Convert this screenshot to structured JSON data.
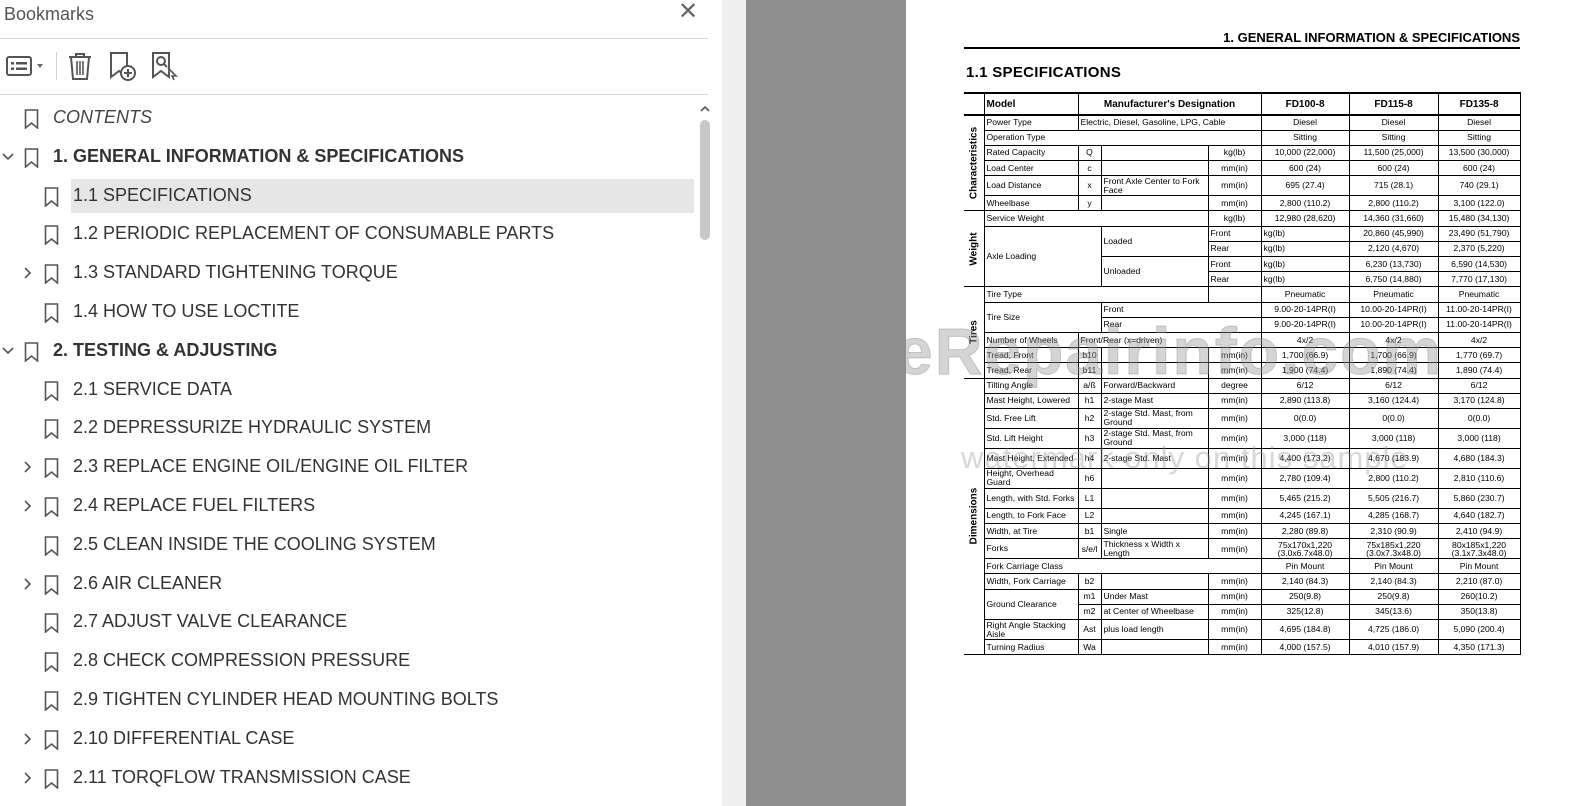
{
  "bookmarks_panel": {
    "title": "Bookmarks",
    "toolbar": {
      "options_icon": "list-options-icon",
      "delete_icon": "trash-icon",
      "new_bookmark_icon": "bookmark-add-icon",
      "find_bookmark_icon": "bookmark-search-icon"
    },
    "items": [
      {
        "label": "CONTENTS",
        "level": 0,
        "expander": "none",
        "style": "italic"
      },
      {
        "label": "1. GENERAL INFORMATION & SPECIFICATIONS",
        "level": 0,
        "expander": "expanded",
        "style": "bold"
      },
      {
        "label": "1.1 SPECIFICATIONS",
        "level": 1,
        "expander": "none",
        "selected": true
      },
      {
        "label": "1.2 PERIODIC REPLACEMENT OF CONSUMABLE PARTS",
        "level": 1,
        "expander": "none"
      },
      {
        "label": "1.3 STANDARD TIGHTENING TORQUE",
        "level": 1,
        "expander": "collapsed"
      },
      {
        "label": "1.4 HOW TO USE LOCTITE",
        "level": 1,
        "expander": "none"
      },
      {
        "label": "2. TESTING & ADJUSTING",
        "level": 0,
        "expander": "expanded",
        "style": "bold"
      },
      {
        "label": "2.1 SERVICE DATA",
        "level": 1,
        "expander": "none"
      },
      {
        "label": "2.2 DEPRESSURIZE HYDRAULIC SYSTEM",
        "level": 1,
        "expander": "none"
      },
      {
        "label": "2.3 REPLACE ENGINE OIL/ENGINE OIL FILTER",
        "level": 1,
        "expander": "collapsed"
      },
      {
        "label": "2.4 REPLACE FUEL FILTERS",
        "level": 1,
        "expander": "collapsed"
      },
      {
        "label": "2.5 CLEAN INSIDE THE COOLING SYSTEM",
        "level": 1,
        "expander": "none"
      },
      {
        "label": "2.6 AIR CLEANER",
        "level": 1,
        "expander": "collapsed"
      },
      {
        "label": "2.7 ADJUST VALVE CLEARANCE",
        "level": 1,
        "expander": "none"
      },
      {
        "label": "2.8 CHECK COMPRESSION PRESSURE",
        "level": 1,
        "expander": "none"
      },
      {
        "label": "2.9 TIGHTEN CYLINDER HEAD MOUNTING BOLTS",
        "level": 1,
        "expander": "none"
      },
      {
        "label": "2.10 DIFFERENTIAL CASE",
        "level": 1,
        "expander": "collapsed"
      },
      {
        "label": "2.11 TORQFLOW TRANSMISSION CASE",
        "level": 1,
        "expander": "collapsed"
      }
    ]
  },
  "document": {
    "header": "1. GENERAL INFORMATION & SPECIFICATIONS",
    "section": "1.1    SPECIFICATIONS",
    "watermark": "eRepairinfo.com",
    "watermark_sub": "watermark only on this sample",
    "table": {
      "headers": [
        "Model",
        "Manufacturer's Designation",
        "FD100-8",
        "FD115-8",
        "FD135-8"
      ],
      "categories": [
        "Characteristics",
        "Weight",
        "Tires",
        "Dimensions"
      ],
      "rows": [
        {
          "item": "Power Type",
          "sym": "",
          "desc": "Electric, Diesel, Gasoline, LPG, Cable",
          "unit": "",
          "v": [
            "Diesel",
            "Diesel",
            "Diesel"
          ]
        },
        {
          "item": "Operation Type",
          "sym": "",
          "desc": "",
          "unit": "",
          "v": [
            "Sitting",
            "Sitting",
            "Sitting"
          ]
        },
        {
          "item": "Rated Capacity",
          "sym": "Q",
          "desc": "",
          "unit": "kg(lb)",
          "v": [
            "10,000 (22,000)",
            "11,500 (25,000)",
            "13,500 (30,000)"
          ]
        },
        {
          "item": "Load Center",
          "sym": "c",
          "desc": "",
          "unit": "mm(in)",
          "v": [
            "600 (24)",
            "600 (24)",
            "600 (24)"
          ]
        },
        {
          "item": "Load Distance",
          "sym": "x",
          "desc": "Front Axle Center to Fork Face",
          "unit": "mm(in)",
          "v": [
            "695 (27.4)",
            "715 (28.1)",
            "740 (29.1)"
          ]
        },
        {
          "item": "Wheelbase",
          "sym": "y",
          "desc": "",
          "unit": "mm(in)",
          "v": [
            "2,800 (110.2)",
            "2,800 (110.2)",
            "3,100 (122.0)"
          ]
        },
        {
          "item": "Service Weight",
          "sym": "",
          "desc": "",
          "unit": "kg(lb)",
          "v": [
            "12,980 (28,620)",
            "14,360 (31,660)",
            "15,480 (34,130)"
          ]
        },
        {
          "item": "Axle Loading",
          "load": "Loaded",
          "pos": "Front",
          "unit": "kg(lb)",
          "v": [
            "20,860 (45,990)",
            "23,490 (51,790)",
            "26,450 (58,310)"
          ]
        },
        {
          "pos": "Rear",
          "unit": "kg(lb)",
          "v": [
            "2,120 (4,670)",
            "2,370 (5,220)",
            "2,530 (5,580)"
          ]
        },
        {
          "load": "Unloaded",
          "pos": "Front",
          "unit": "kg(lb)",
          "v": [
            "6,230 (13,730)",
            "6,590 (14,530)",
            "7,110 (15,670)"
          ]
        },
        {
          "pos": "Rear",
          "unit": "kg(lb)",
          "v": [
            "6,750 (14,880)",
            "7,770 (17,130)",
            "8,370 (18,450)"
          ]
        },
        {
          "item": "Tire Type",
          "sym": "",
          "desc": "",
          "unit": "",
          "v": [
            "Pneumatic",
            "Pneumatic",
            "Pneumatic"
          ]
        },
        {
          "item": "Tire Size",
          "desc": "Front",
          "unit": "",
          "v": [
            "9.00-20-14PR(I)",
            "10.00-20-14PR(I)",
            "11.00-20-14PR(I)"
          ]
        },
        {
          "desc": "Rear",
          "unit": "",
          "v": [
            "9.00-20-14PR(I)",
            "10.00-20-14PR(I)",
            "11.00-20-14PR(I)"
          ]
        },
        {
          "item": "Number of Wheels",
          "desc": "Front/Rear (x=driven)",
          "unit": "",
          "v": [
            "4x/2",
            "4x/2",
            "4x/2"
          ]
        },
        {
          "item": "Tread, Front",
          "sym": "b10",
          "desc": "",
          "unit": "mm(in)",
          "v": [
            "1,700 (66.9)",
            "1,700 (66.9)",
            "1,770 (69.7)"
          ]
        },
        {
          "item": "Tread, Rear",
          "sym": "b11",
          "desc": "",
          "unit": "mm(in)",
          "v": [
            "1,900 (74.4)",
            "1,890 (74.4)",
            "1,890 (74.4)"
          ]
        },
        {
          "item": "Tilting Angle",
          "sym": "a/ß",
          "desc": "Forward/Backward",
          "unit": "degree",
          "v": [
            "6/12",
            "6/12",
            "6/12"
          ]
        },
        {
          "item": "Mast Height, Lowered",
          "sym": "h1",
          "desc": "2-stage Mast",
          "unit": "mm(in)",
          "v": [
            "2,890 (113.8)",
            "3,160 (124.4)",
            "3,170 (124.8)"
          ]
        },
        {
          "item": "Std. Free Lift",
          "sym": "h2",
          "desc": "2-stage Std. Mast, from Ground",
          "unit": "mm(in)",
          "v": [
            "0(0.0)",
            "0(0.0)",
            "0(0.0)"
          ]
        },
        {
          "item": "Std. Lift Height",
          "sym": "h3",
          "desc": "2-stage Std. Mast, from Ground",
          "unit": "mm(in)",
          "v": [
            "3,000 (118)",
            "3,000 (118)",
            "3,000 (118)"
          ]
        },
        {
          "item": "Mast Height, Extended",
          "sym": "h4",
          "desc": "2-stage Std. Mast",
          "unit": "mm(in)",
          "v": [
            "4,400 (173.2)",
            "4,670 (183.9)",
            "4,680 (184.3)"
          ]
        },
        {
          "item": "Height, Overhead Guard",
          "sym": "h6",
          "desc": "",
          "unit": "mm(in)",
          "v": [
            "2,780 (109.4)",
            "2,800 (110.2)",
            "2,810 (110.6)"
          ]
        },
        {
          "item": "Length, with Std. Forks",
          "sym": "L1",
          "desc": "",
          "unit": "mm(in)",
          "v": [
            "5,465 (215.2)",
            "5,505 (216.7)",
            "5,860 (230.7)"
          ]
        },
        {
          "item": "Length, to Fork Face",
          "sym": "L2",
          "desc": "",
          "unit": "mm(in)",
          "v": [
            "4,245 (167.1)",
            "4,285 (168.7)",
            "4,640 (182.7)"
          ]
        },
        {
          "item": "Width, at Tire",
          "sym": "b1",
          "desc": "Single",
          "unit": "mm(in)",
          "v": [
            "2,280 (89.8)",
            "2,310 (90.9)",
            "2,410 (94.9)"
          ]
        },
        {
          "item": "Forks",
          "sym": "s/e/l",
          "desc": "Thickness x Width x Length",
          "unit": "mm(in)",
          "v": [
            "75x170x1,220 (3.0x6.7x48.0)",
            "75x185x1,220 (3.0x7.3x48.0)",
            "80x185x1,220 (3.1x7.3x48.0)"
          ]
        },
        {
          "item": "Fork Carriage Class",
          "sym": "",
          "desc": "",
          "unit": "",
          "v": [
            "Pin Mount",
            "Pin Mount",
            "Pin Mount"
          ]
        },
        {
          "item": "Width, Fork Carriage",
          "sym": "b2",
          "desc": "",
          "unit": "mm(in)",
          "v": [
            "2,140 (84.3)",
            "2,140 (84.3)",
            "2,210 (87.0)"
          ]
        },
        {
          "item": "Ground Clearance",
          "sym": "m1",
          "desc": "Under Mast",
          "unit": "mm(in)",
          "v": [
            "250(9.8)",
            "250(9.8)",
            "260(10.2)"
          ]
        },
        {
          "sym": "m2",
          "desc": "at Center of Wheelbase",
          "unit": "mm(in)",
          "v": [
            "325(12.8)",
            "345(13.6)",
            "350(13.8)"
          ]
        },
        {
          "item": "Right Angle Stacking Aisle",
          "sym": "Ast",
          "desc": "plus load length",
          "unit": "mm(in)",
          "v": [
            "4,695 (184.8)",
            "4,725 (186.0)",
            "5,090 (200.4)"
          ]
        },
        {
          "item": "Turning Radius",
          "sym": "Wa",
          "desc": "",
          "unit": "mm(in)",
          "v": [
            "4,000 (157.5)",
            "4,010 (157.9)",
            "4,350 (171.3)"
          ]
        }
      ]
    }
  }
}
